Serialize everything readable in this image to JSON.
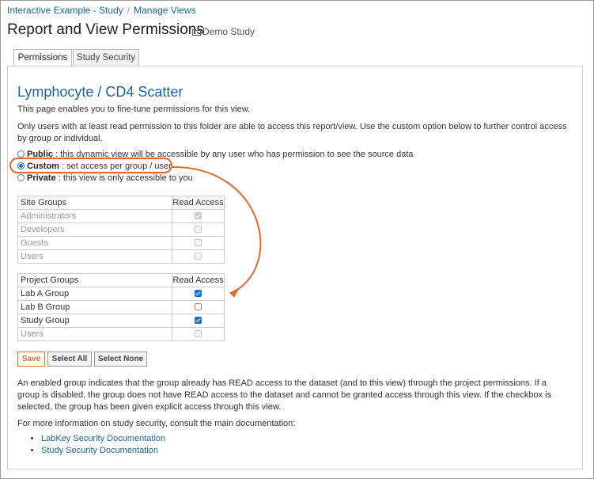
{
  "breadcrumb": {
    "items": [
      "Interactive Example - Study",
      "Manage Views"
    ],
    "separator": "/"
  },
  "page": {
    "title": "Report and View Permissions",
    "folder": "Demo Study"
  },
  "tabs": [
    "Permissions",
    "Study Security"
  ],
  "view": {
    "title": "Lymphocyte / CD4 Scatter",
    "intro": "This page enables you to fine-tune permissions for this view.",
    "note": "Only users with at least read permission to this folder are able to access this report/view. Use the custom option below to further control access by group or individual."
  },
  "options": [
    {
      "label": "Public",
      "desc": " : this dynamic view will be accessible by any user who has permission to see the source data",
      "selected": false
    },
    {
      "label": "Custom",
      "desc": " : set access per group / user",
      "selected": true
    },
    {
      "label": "Private",
      "desc": " : this view is only accessible to you",
      "selected": false
    }
  ],
  "site_groups": {
    "header": [
      "Site Groups",
      "Read Access"
    ],
    "rows": [
      {
        "name": "Administrators",
        "checked": true,
        "disabled": true
      },
      {
        "name": "Developers",
        "checked": false,
        "disabled": true
      },
      {
        "name": "Guests",
        "checked": false,
        "disabled": true
      },
      {
        "name": "Users",
        "checked": false,
        "disabled": true
      }
    ]
  },
  "project_groups": {
    "header": [
      "Project Groups",
      "Read Access"
    ],
    "rows": [
      {
        "name": "Lab A Group",
        "checked": true,
        "disabled": false
      },
      {
        "name": "Lab B Group",
        "checked": false,
        "disabled": false
      },
      {
        "name": "Study Group",
        "checked": true,
        "disabled": false
      },
      {
        "name": "Users",
        "checked": false,
        "disabled": true
      }
    ]
  },
  "buttons": {
    "save": "Save",
    "select_all": "Select All",
    "select_none": "Select None"
  },
  "explanation": "An enabled group indicates that the group already has READ access to the dataset (and to this view) through the project permissions. If a group is disabled, the group does not have READ access to the dataset and cannot be granted access through this view. If the checkbox is selected, the group has been given explicit access through this view.",
  "more_info": "For more information on study security, consult the main documentation:",
  "links": [
    "LabKey Security Documentation",
    "Study Security Documentation"
  ],
  "colors": {
    "link": "#126495",
    "heading": "#1a64a5",
    "accent": "#e06a2c",
    "check": "#1a6fd1"
  }
}
